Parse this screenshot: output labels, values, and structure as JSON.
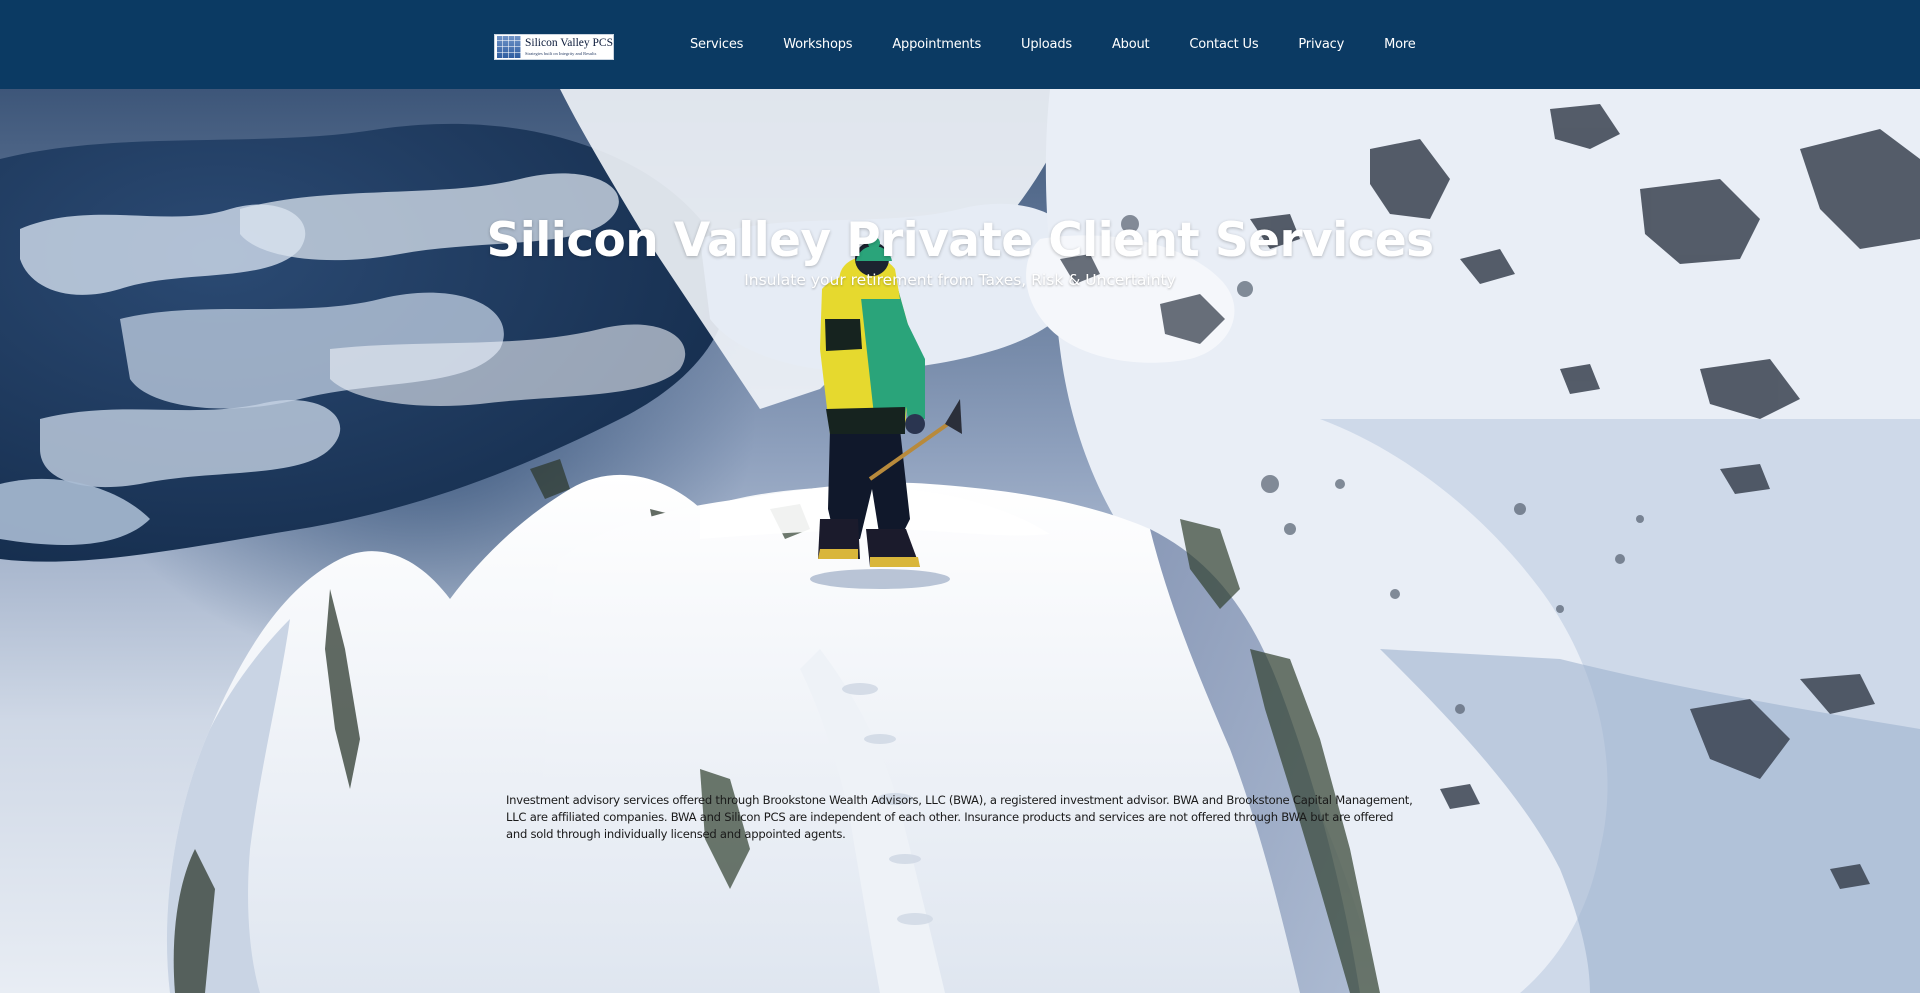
{
  "header": {
    "logo": {
      "title": "Silicon Valley PCS",
      "tagline": "Strategies built on Integrity and Results"
    },
    "nav": [
      {
        "label": "Services"
      },
      {
        "label": "Workshops"
      },
      {
        "label": "Appointments"
      },
      {
        "label": "Uploads"
      },
      {
        "label": "About"
      },
      {
        "label": "Contact Us"
      },
      {
        "label": "Privacy"
      },
      {
        "label": "More"
      }
    ]
  },
  "hero": {
    "title": "Silicon Valley Private Client Services",
    "subtitle": "Insulate your retirement from Taxes, Risk & Uncertainty",
    "disclaimer": "Investment advisory services offered through Brookstone Wealth Advisors, LLC (BWA), a registered investment advisor.  BWA and Brookstone Capital Management, LLC are affiliated companies. BWA and Silicon PCS are independent of each other.   Insurance products and services are not offered through BWA but are offered and sold through individually licensed and appointed agents."
  },
  "colors": {
    "header_background": "#0b3a63",
    "nav_text": "#ffffff",
    "hero_title": "#ffffff",
    "disclaimer_text": "#1a1a1a"
  }
}
